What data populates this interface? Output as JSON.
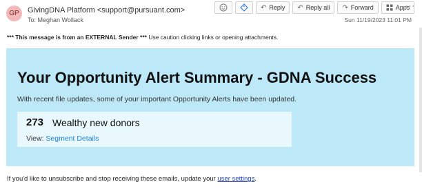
{
  "header": {
    "avatar_initials": "GP",
    "sender": "GivingDNA Platform <support@pursuant.com>",
    "to_prefix": "To:",
    "to_name": "Meghan Wollack",
    "datetime": "Sun 11/19/2023 11:01 PM"
  },
  "toolbar": {
    "emoji_icon": "smiley-icon",
    "tag_icon": "tag-icon",
    "reply_label": "Reply",
    "reply_all_label": "Reply all",
    "forward_label": "Forward",
    "apps_label": "Apps",
    "more_label": "···"
  },
  "warning": {
    "bold": "*** This message is from an EXTERNAL Sender ***",
    "text": " Use caution clicking links or opening attachments."
  },
  "card": {
    "title": "Your Opportunity Alert Summary - GDNA Success",
    "subtitle": "With recent file updates, some of your important Opportunity Alerts have been updated.",
    "alert": {
      "count": "273",
      "label": "Wealthy new donors",
      "view_prefix": "View: ",
      "view_link": "Segment Details"
    }
  },
  "footer": {
    "text": "If you'd like to unsubscribe and stop receiving these emails, update your ",
    "link": "user settings",
    "end": "."
  },
  "colors": {
    "card_bg": "#bde8f8",
    "alert_bg": "#e9f8fd",
    "link": "#1d82d6",
    "avatar_bg": "#f3b9ba"
  }
}
